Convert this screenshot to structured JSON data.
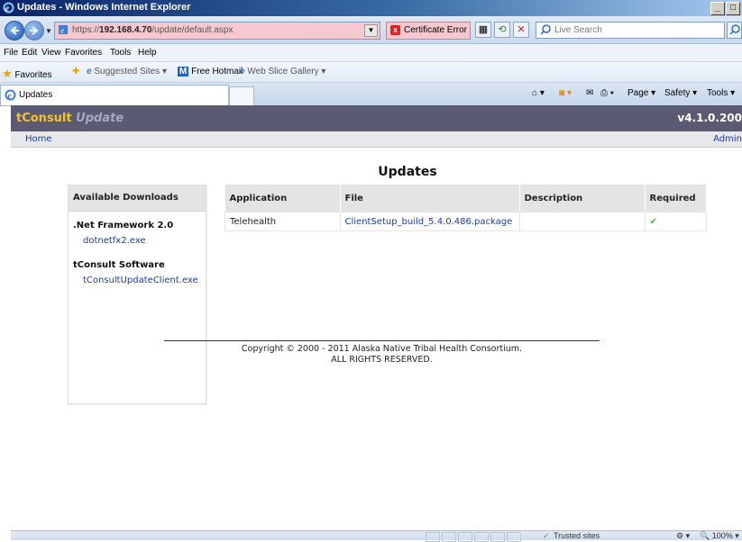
{
  "window": {
    "title": "Updates - Windows Internet Explorer"
  },
  "address": {
    "prefix": "https://",
    "host": "192.168.4.70",
    "path": "/update/default.aspx",
    "cert_error": "Certificate Error",
    "search_placeholder": "Live Search"
  },
  "menu": [
    "File",
    "Edit",
    "View",
    "Favorites",
    "Tools",
    "Help"
  ],
  "favorites_bar": {
    "favorites": "Favorites",
    "suggested": "Suggested Sites ▾",
    "hotmail": "Free Hotmail",
    "slice": "Web Slice Gallery ▾"
  },
  "tab": {
    "title": "Updates"
  },
  "commands": {
    "page": "Page ▾",
    "safety": "Safety ▾",
    "tools": "Tools ▾"
  },
  "site": {
    "brand": "tConsult",
    "brand_sub": "Update",
    "version": "v4.1.0.200",
    "nav_home": "Home",
    "nav_admin": "Admin"
  },
  "page": {
    "heading": "Updates"
  },
  "downloads": {
    "header": "Available Downloads",
    "groups": [
      {
        "title": ".Net Framework 2.0",
        "file": "dotnetfx2.exe"
      },
      {
        "title": "tConsult Software",
        "file": "tConsultUpdateClient.exe"
      }
    ]
  },
  "updates_table": {
    "columns": [
      "Application",
      "File",
      "Description",
      "Required"
    ],
    "rows": [
      {
        "application": "Telehealth",
        "file": "ClientSetup_build_5.4.0.486.package",
        "description": "",
        "required": "✔"
      }
    ]
  },
  "footer": {
    "line1": "Copyright © 2000 - 2011 Alaska Native Tribal Health Consortium.",
    "line2": "ALL RIGHTS RESERVED."
  },
  "status": {
    "zone": "Trusted sites",
    "zoom": "100%"
  },
  "colors": {
    "banner": "#5a5a72",
    "brand": "#f4c430",
    "link": "#1a3e9e",
    "check": "#3bbf3b"
  }
}
